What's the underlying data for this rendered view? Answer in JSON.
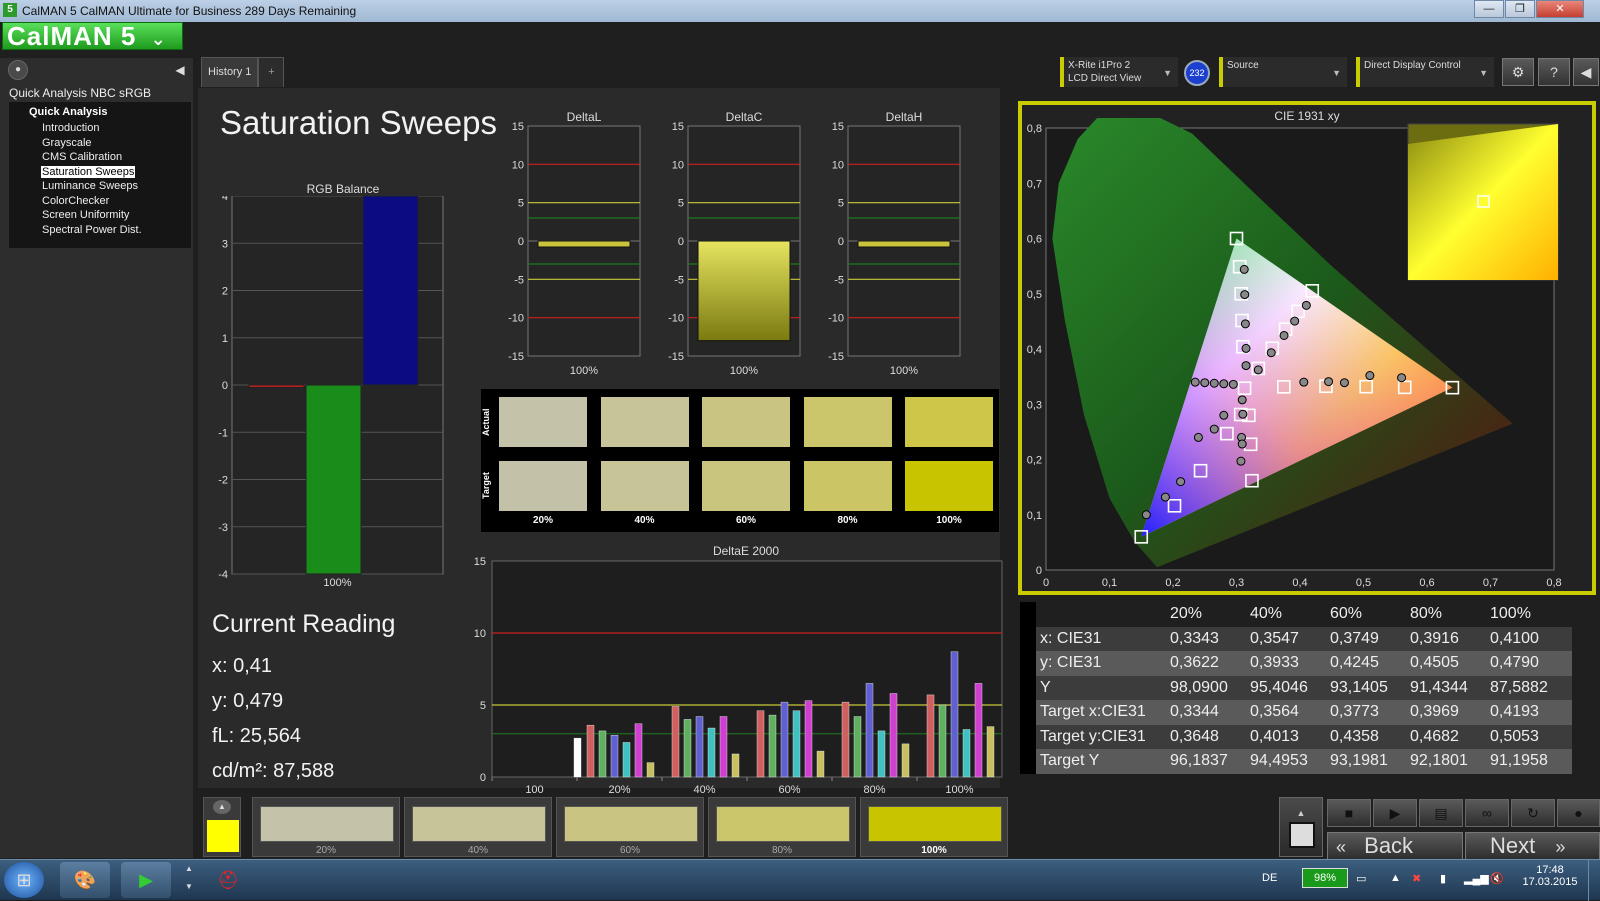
{
  "window": {
    "title": "CalMAN 5 CalMAN Ultimate for Business 289 Days Remaining",
    "app_icon": "5",
    "controls": {
      "minimize": "—",
      "maximize": "❐",
      "close": "✕"
    }
  },
  "logo": {
    "text": "CalMAN 5",
    "dropdown": "⌄"
  },
  "sidebar": {
    "title": "Quick Analysis NBC sRGB",
    "tree_root": "Quick Analysis",
    "items": [
      {
        "label": "Introduction"
      },
      {
        "label": "Grayscale"
      },
      {
        "label": "CMS Calibration"
      },
      {
        "label": "Saturation Sweeps",
        "selected": true
      },
      {
        "label": "Luminance Sweeps"
      },
      {
        "label": "ColorChecker"
      },
      {
        "label": "Screen Uniformity"
      },
      {
        "label": "Spectral Power Dist."
      }
    ]
  },
  "tabs": [
    {
      "label": "History 1"
    },
    {
      "label": "+"
    }
  ],
  "header": {
    "meter": {
      "line1": "X-Rite i1Pro 2",
      "line2": "LCD Direct View",
      "badge": "232"
    },
    "source": {
      "label": "Source"
    },
    "display": {
      "label": "Direct Display Control"
    },
    "icons": [
      "gear-icon",
      "help-icon",
      "collapse-icon"
    ]
  },
  "page_title": "Saturation Sweeps",
  "colors": {
    "accent": "#c8cc00",
    "target_yellow": "#c9c400",
    "red": "#cc2020",
    "green": "#1a8c1a",
    "blue": "#0c0c80"
  },
  "chart_data": [
    {
      "type": "bar",
      "title": "RGB Balance",
      "categories": [
        "100%"
      ],
      "series": [
        {
          "values": [
            -0.05
          ],
          "color": "#cc2020"
        },
        {
          "values": [
            -4.0
          ],
          "color": "#1a8c1a"
        },
        {
          "values": [
            4.0
          ],
          "color": "#0c0c80"
        }
      ],
      "ylim": [
        -4,
        4
      ],
      "yticks": [
        4,
        3,
        2,
        1,
        0,
        -1,
        -2,
        -3,
        -4
      ]
    },
    {
      "type": "bar",
      "title": "DeltaL",
      "categories": [
        "100%"
      ],
      "values": [
        -0.5
      ],
      "ylim": [
        -15,
        15
      ],
      "yticks": [
        15,
        10,
        5,
        0,
        -5,
        -10,
        -15
      ]
    },
    {
      "type": "bar",
      "title": "DeltaC",
      "categories": [
        "100%"
      ],
      "values": [
        -13
      ],
      "ylim": [
        -15,
        15
      ],
      "yticks": [
        15,
        10,
        5,
        0,
        -5,
        -10,
        -15
      ]
    },
    {
      "type": "bar",
      "title": "DeltaH",
      "categories": [
        "100%"
      ],
      "values": [
        -0.5
      ],
      "ylim": [
        -15,
        15
      ],
      "yticks": [
        15,
        10,
        5,
        0,
        -5,
        -10,
        -15
      ]
    },
    {
      "type": "bar",
      "title": "DeltaE 2000",
      "categories": [
        "100",
        "20%",
        "40%",
        "60%",
        "80%",
        "100%"
      ],
      "ylim": [
        0,
        15
      ],
      "yticks": [
        15,
        10,
        5,
        0
      ],
      "bar_colors": [
        "#d06060",
        "#60b060",
        "#6060d0",
        "#40c0c0",
        "#d040d0",
        "#c8c060",
        "#ffffff"
      ],
      "groups": [
        [
          0,
          0,
          0,
          0,
          0,
          0,
          2.7
        ],
        [
          3.6,
          3.2,
          2.9,
          2.4,
          3.7,
          1.0
        ],
        [
          4.9,
          4.0,
          4.2,
          3.4,
          4.2,
          1.6
        ],
        [
          4.6,
          4.3,
          5.2,
          4.6,
          5.3,
          1.8
        ],
        [
          5.2,
          4.2,
          6.5,
          3.2,
          5.8,
          2.3
        ],
        [
          5.7,
          5.0,
          8.7,
          3.3,
          6.5,
          3.5
        ]
      ]
    },
    {
      "type": "scatter",
      "title": "CIE 1931 xy",
      "xlim": [
        0,
        0.8
      ],
      "ylim": [
        0,
        0.8
      ],
      "xticks": [
        "0",
        "0,1",
        "0,2",
        "0,3",
        "0,4",
        "0,5",
        "0,6",
        "0,7",
        "0,8"
      ],
      "yticks": [
        "0,8",
        "0,7",
        "0,6",
        "0,5",
        "0,4",
        "0,3",
        "0,2",
        "0,1",
        "0"
      ],
      "gamut": [
        [
          0.64,
          0.33
        ],
        [
          0.3,
          0.6
        ],
        [
          0.15,
          0.06
        ]
      ],
      "targets": [
        [
          0.3344,
          0.3648
        ],
        [
          0.3564,
          0.4013
        ],
        [
          0.3773,
          0.4358
        ],
        [
          0.3969,
          0.4682
        ],
        [
          0.4193,
          0.5053
        ],
        [
          0.3127,
          0.329
        ],
        [
          0.3745,
          0.3315
        ],
        [
          0.4409,
          0.3326
        ],
        [
          0.5042,
          0.3318
        ],
        [
          0.5649,
          0.3306
        ],
        [
          0.64,
          0.33
        ],
        [
          0.3,
          0.6
        ],
        [
          0.3049,
          0.5489
        ],
        [
          0.3073,
          0.4999
        ],
        [
          0.3088,
          0.4515
        ],
        [
          0.31,
          0.4041
        ],
        [
          0.3066,
          0.2814
        ],
        [
          0.2849,
          0.2468
        ],
        [
          0.2434,
          0.1797
        ],
        [
          0.2024,
          0.1162
        ],
        [
          0.15,
          0.06
        ],
        [
          0.3194,
          0.2799
        ],
        [
          0.3222,
          0.2275
        ],
        [
          0.3243,
          0.1616
        ]
      ],
      "actual": [
        [
          0.3343,
          0.3622
        ],
        [
          0.3547,
          0.3933
        ],
        [
          0.3749,
          0.4245
        ],
        [
          0.3916,
          0.4505
        ],
        [
          0.41,
          0.479
        ],
        [
          0.3122,
          0.5441
        ],
        [
          0.313,
          0.4985
        ],
        [
          0.314,
          0.4455
        ],
        [
          0.315,
          0.4011
        ],
        [
          0.315,
          0.37
        ],
        [
          0.406,
          0.34
        ],
        [
          0.445,
          0.341
        ],
        [
          0.47,
          0.339
        ],
        [
          0.51,
          0.352
        ],
        [
          0.56,
          0.348
        ],
        [
          0.24,
          0.24
        ],
        [
          0.265,
          0.255
        ],
        [
          0.28,
          0.28
        ],
        [
          0.212,
          0.16
        ],
        [
          0.188,
          0.132
        ],
        [
          0.158,
          0.1
        ],
        [
          0.235,
          0.34
        ],
        [
          0.25,
          0.339
        ],
        [
          0.265,
          0.338
        ],
        [
          0.28,
          0.337
        ],
        [
          0.295,
          0.336
        ],
        [
          0.309,
          0.308
        ],
        [
          0.31,
          0.282
        ],
        [
          0.308,
          0.24
        ],
        [
          0.307,
          0.197
        ],
        [
          0.309,
          0.228
        ]
      ],
      "current": [
        0.41,
        0.479
      ]
    }
  ],
  "swatches": {
    "actual_label": "Actual",
    "target_label": "Target",
    "labels": [
      "20%",
      "40%",
      "60%",
      "80%",
      "100%"
    ],
    "actual": [
      "#c4c3a9",
      "#c8c499",
      "#cac483",
      "#cbc56c",
      "#cdc648"
    ],
    "target": [
      "#c3c2a8",
      "#c7c497",
      "#c9c47e",
      "#cbc565",
      "#c8c500"
    ]
  },
  "current_reading": {
    "title": "Current Reading",
    "x": "x: 0,41",
    "y": "y: 0,479",
    "fL": "fL: 25,564",
    "cd": "cd/m²: 87,588"
  },
  "table": {
    "headers": [
      "20%",
      "40%",
      "60%",
      "80%",
      "100%"
    ],
    "rows": [
      {
        "label": "x: CIE31",
        "values": [
          "0,3343",
          "0,3547",
          "0,3749",
          "0,3916",
          "0,4100"
        ]
      },
      {
        "label": "y: CIE31",
        "values": [
          "0,3622",
          "0,3933",
          "0,4245",
          "0,4505",
          "0,4790"
        ]
      },
      {
        "label": "Y",
        "values": [
          "98,0900",
          "95,4046",
          "93,1405",
          "91,4344",
          "87,5882"
        ]
      },
      {
        "label": "Target x:CIE31",
        "values": [
          "0,3344",
          "0,3564",
          "0,3773",
          "0,3969",
          "0,4193"
        ]
      },
      {
        "label": "Target y:CIE31",
        "values": [
          "0,3648",
          "0,4013",
          "0,4358",
          "0,4682",
          "0,5053"
        ]
      },
      {
        "label": "Target Y",
        "values": [
          "96,1837",
          "94,4953",
          "93,1981",
          "92,1801",
          "91,1958"
        ]
      }
    ]
  },
  "bottom": {
    "swatches": [
      {
        "label": "20%",
        "color": "#c4c3a9"
      },
      {
        "label": "40%",
        "color": "#c8c499"
      },
      {
        "label": "60%",
        "color": "#cac483"
      },
      {
        "label": "80%",
        "color": "#cbc56c"
      },
      {
        "label": "100%",
        "color": "#c8c500",
        "selected": true
      }
    ],
    "back": "Back",
    "next": "Next",
    "back_arrow": "«",
    "next_arrow": "»"
  },
  "taskbar": {
    "lang": "DE",
    "battery": "98%",
    "time": "17:48",
    "date": "17.03.2015"
  }
}
